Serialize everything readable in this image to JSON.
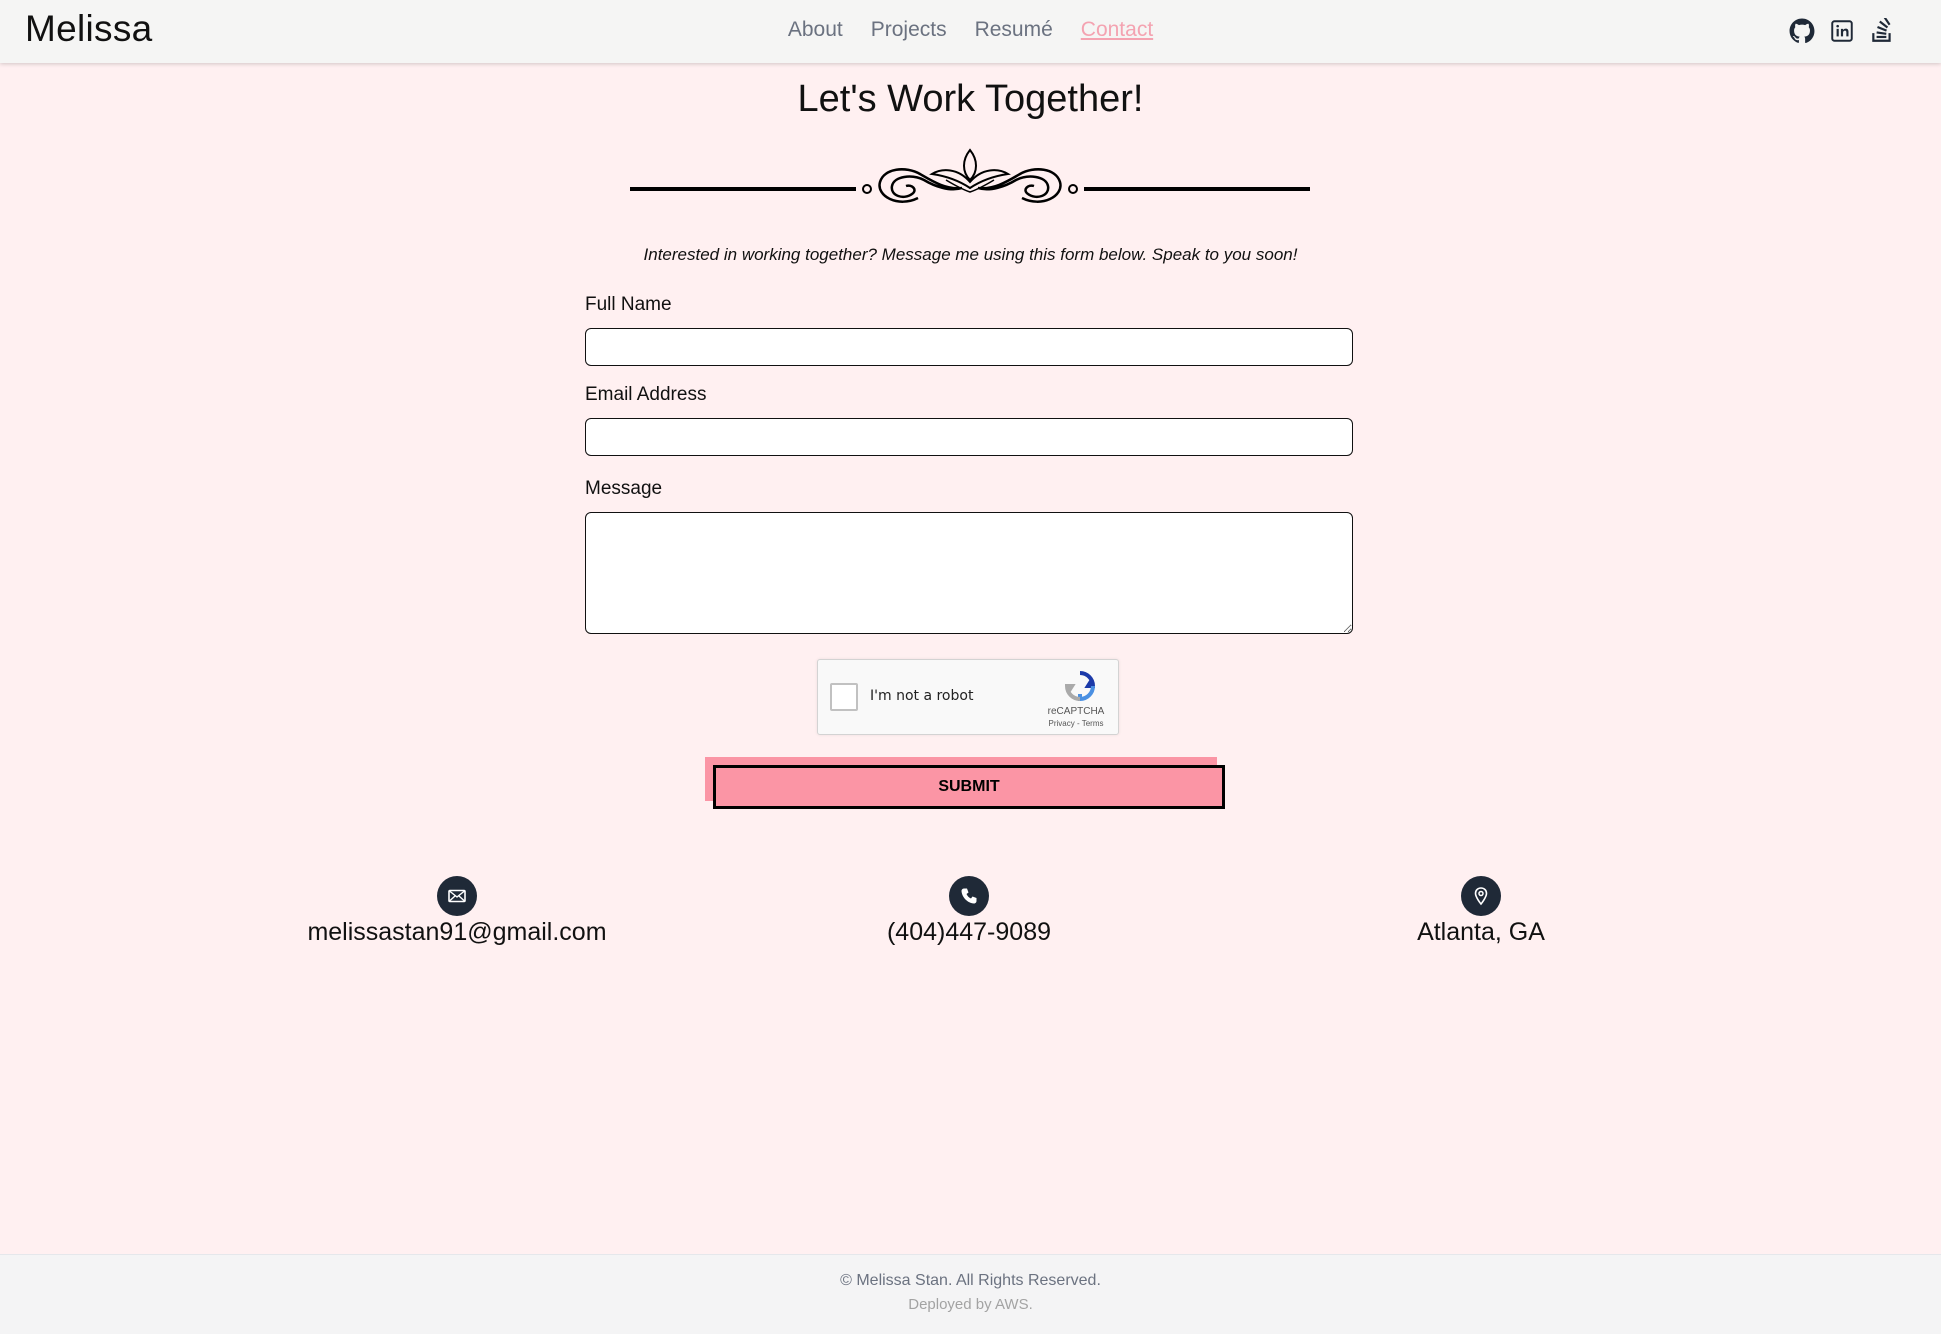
{
  "navbar": {
    "brand": "Melissa",
    "links": [
      {
        "label": "About"
      },
      {
        "label": "Projects"
      },
      {
        "label": "Resumé"
      },
      {
        "label": "Contact",
        "active": true
      }
    ],
    "social_icons": [
      "github-icon",
      "linkedin-icon",
      "stackoverflow-icon"
    ]
  },
  "main": {
    "title": "Let's Work Together!",
    "intro": "Interested in working together? Message me using this form below. Speak to you soon!",
    "form": {
      "full_name_label": "Full Name",
      "full_name_value": "",
      "email_label": "Email Address",
      "email_value": "",
      "message_label": "Message",
      "message_value": "",
      "recaptcha_label": "I'm not a robot",
      "recaptcha_brand": "reCAPTCHA",
      "recaptcha_links": "Privacy - Terms",
      "submit_label": "SUBMIT"
    }
  },
  "contact_info": {
    "email": "melissastan91@gmail.com",
    "phone": "(404)447-9089",
    "location": "Atlanta, GA"
  },
  "footer": {
    "copyright": "© Melissa Stan. All Rights Reserved.",
    "deployed": "Deployed by AWS."
  },
  "colors": {
    "page_bg": "#fff0f1",
    "accent_pink": "#fb95a5",
    "active_link": "#f4a3b1",
    "icon_circle": "#1f2937"
  }
}
